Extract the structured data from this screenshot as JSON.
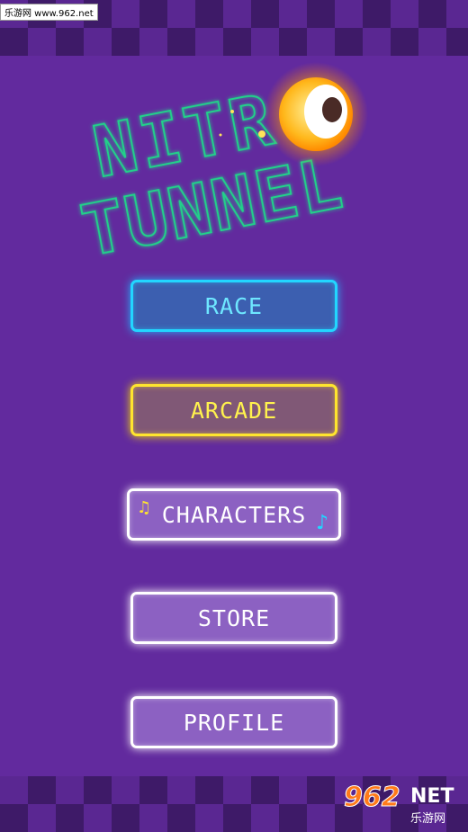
{
  "watermark": {
    "top_text": "乐游网 www.962.net",
    "bottom_number": "962",
    "bottom_net": "NET",
    "bottom_cn": "乐游网"
  },
  "logo": {
    "line1": "NITR",
    "line2": "TUNNEL",
    "color": "#21d18a",
    "ball_icon": "glowing-ball-icon"
  },
  "menu": {
    "race": "RACE",
    "arcade": "ARCADE",
    "characters": "CHARACTERS",
    "store": "STORE",
    "profile": "PROFILE"
  },
  "icons": {
    "note_left": "♫",
    "note_right": "♪"
  },
  "colors": {
    "background": "#622a9e",
    "race_border": "#22d6ff",
    "arcade_border": "#ffe52e",
    "white_border": "#ffffff"
  }
}
